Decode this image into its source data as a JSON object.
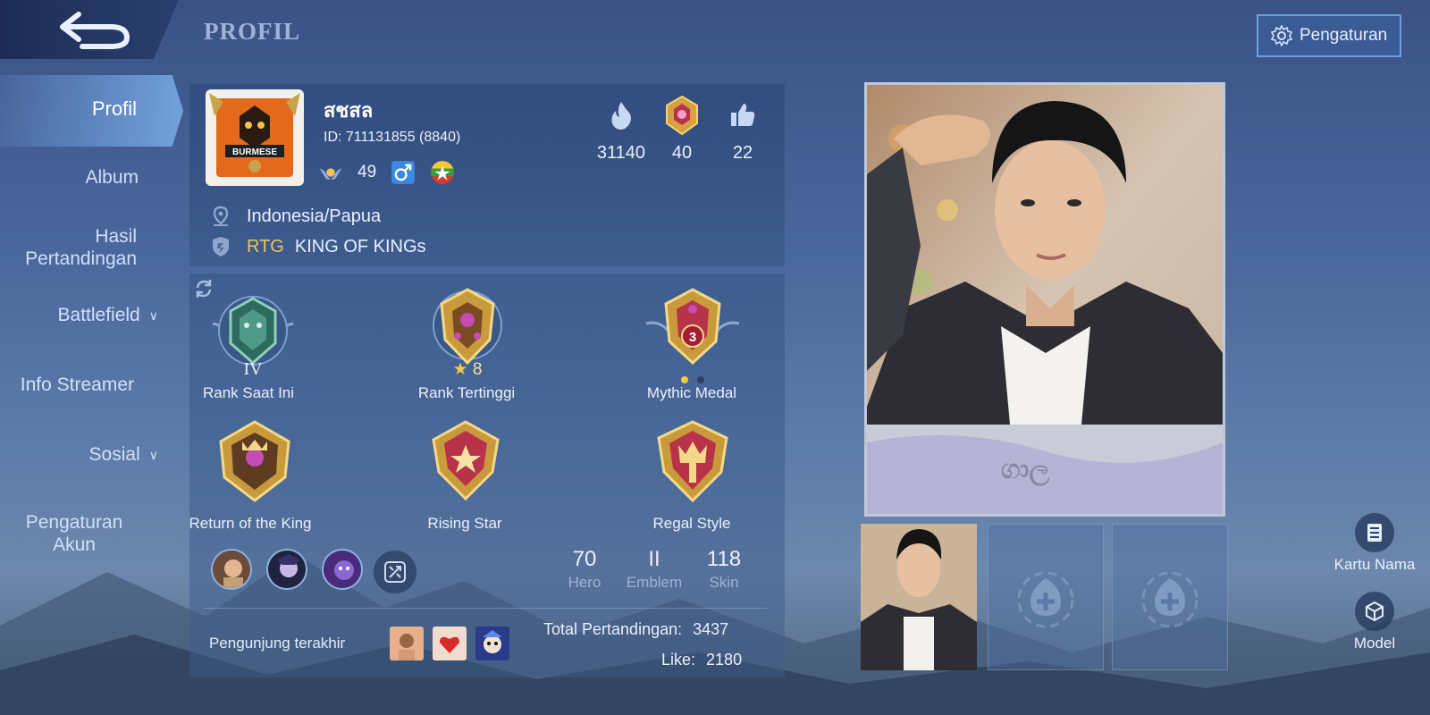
{
  "header": {
    "title": "PROFIL",
    "settings_label": "Pengaturan"
  },
  "sidebar": {
    "items": [
      {
        "label": "Profil",
        "active": true
      },
      {
        "label": "Album"
      },
      {
        "label": "Hasil Pertandingan"
      },
      {
        "label": "Battlefield",
        "has_dropdown": true
      },
      {
        "label": "Info Streamer"
      },
      {
        "label": "Sosial",
        "has_dropdown": true
      },
      {
        "label": "Pengaturan Akun"
      }
    ]
  },
  "player": {
    "name": "สชสล",
    "id_text": "ID: 711131855 (8840)",
    "level": "49",
    "avatar_badge_text": "BURMESE",
    "stats": {
      "popularity": "31140",
      "charisma": "40",
      "likes": "22"
    },
    "location": "Indonesia/Papua",
    "squad_abbr": "RTG",
    "squad_name": "KING OF KINGs"
  },
  "medals": {
    "current_rank": {
      "label": "Rank Saat Ini",
      "tier": "IV"
    },
    "highest_rank": {
      "label": "Rank Tertinggi",
      "stars": "8"
    },
    "mythic_medal": {
      "label": "Mythic Medal",
      "value": "3"
    },
    "return_of_the_king": {
      "label": "Return of the King"
    },
    "rising_star": {
      "label": "Rising Star"
    },
    "regal_style": {
      "label": "Regal Style"
    }
  },
  "counts": {
    "hero": {
      "value": "70",
      "label": "Hero"
    },
    "emblem": {
      "value": "II",
      "label": "Emblem"
    },
    "skin": {
      "value": "118",
      "label": "Skin"
    }
  },
  "visitors": {
    "label": "Pengunjung terakhir"
  },
  "totals": {
    "matches_label": "Total Pertandingan:",
    "matches_value": "3437",
    "like_label": "Like:",
    "like_value": "2180"
  },
  "photo_wall": {
    "main_photo_text": "ගාල"
  },
  "right_buttons": {
    "name_card_label": "Kartu Nama",
    "model_label": "Model"
  },
  "icons": {
    "back": "back-arrow-icon",
    "settings": "gear-icon",
    "popularity": "flame-icon",
    "charisma": "medal-icon",
    "likes": "thumbs-up-icon",
    "location": "location-pin-icon",
    "squad": "squad-shield-icon",
    "gender": "male-icon",
    "flag": "myanmar-flag-icon"
  },
  "colors": {
    "accent_gold": "#f0c45a",
    "accent_blue": "#6e9ee0"
  }
}
